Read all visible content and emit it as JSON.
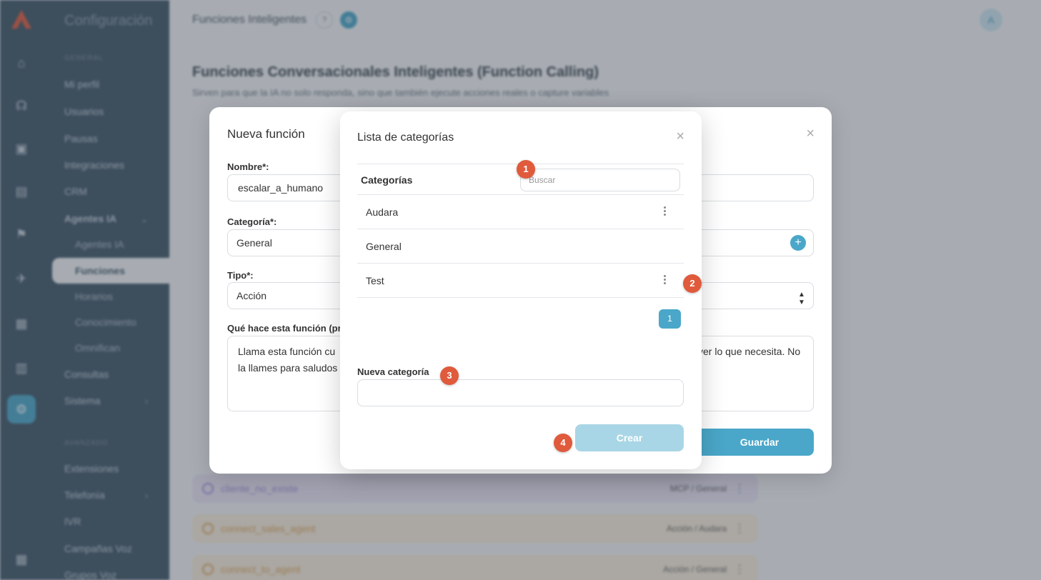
{
  "colors": {
    "accent": "#4aa7c9",
    "sidebar": "#3f5567",
    "step_marker": "#e05a3c",
    "crear_disabled": "#a9d6e6"
  },
  "sidebar": {
    "app_title": "Configuración",
    "section_1": "GENERAL",
    "items": [
      {
        "label": "Mi perfil"
      },
      {
        "label": "Usuarios"
      },
      {
        "label": "Pausas"
      },
      {
        "label": "Integraciones"
      },
      {
        "label": "CRM"
      },
      {
        "label": "Agentes IA"
      },
      {
        "label": "Agentes IA"
      },
      {
        "label": "Funciones"
      },
      {
        "label": "Horarios"
      },
      {
        "label": "Conocimiento"
      },
      {
        "label": "Omnifican"
      },
      {
        "label": "Consultas"
      },
      {
        "label": "Sistema"
      }
    ],
    "section_2": "AVANZADO",
    "items_2": [
      {
        "label": "Extensiones"
      },
      {
        "label": "Telefonía"
      },
      {
        "label": "IVR"
      },
      {
        "label": "Campañas Voz"
      },
      {
        "label": "Grupos Voz"
      }
    ]
  },
  "topbar": {
    "title": "Funciones Inteligentes",
    "help_icon": "?",
    "avatar_letter": "A"
  },
  "page": {
    "heading": "Funciones Conversacionales Inteligentes (Function Calling)",
    "subheading": "Sirven para que la IA no solo responda, sino que también ejecute acciones reales o capture variables",
    "rows": [
      {
        "name": "cliente_no_existe",
        "meta": "MCP / General",
        "color": "#ece6f7",
        "fg": "#a58fdc"
      },
      {
        "name": "connect_sales_agent",
        "meta": "Acción / Audara",
        "color": "#fbeedc",
        "fg": "#e0a95c"
      },
      {
        "name": "connect_to_agent",
        "meta": "Acción / General",
        "color": "#fbeedc",
        "fg": "#e0a95c"
      }
    ]
  },
  "nueva_funcion": {
    "title": "Nueva función",
    "nombre_label": "Nombre*:",
    "nombre_value": "escalar_a_humano",
    "categoria_label": "Categoría*:",
    "categoria_value": "General",
    "tipo_label": "Tipo*:",
    "tipo_value": "Acción",
    "desc_label": "Qué hace esta función (pro",
    "desc_value_left": "Llama esta función cu",
    "desc_value_left2": "la llames para saludos",
    "desc_value_right": "ver lo que necesita. No",
    "save_label": "Guardar"
  },
  "categorias": {
    "title": "Lista de categorías",
    "header_label": "Categorías",
    "search_placeholder": "Buscar",
    "rows": [
      {
        "name": "Audara",
        "has_menu": true
      },
      {
        "name": "General",
        "has_menu": false
      },
      {
        "name": "Test",
        "has_menu": true
      }
    ],
    "page": "1",
    "new_label": "Nueva categoría",
    "new_value": "",
    "create_label": "Crear"
  },
  "steps": [
    "1",
    "2",
    "3",
    "4"
  ]
}
